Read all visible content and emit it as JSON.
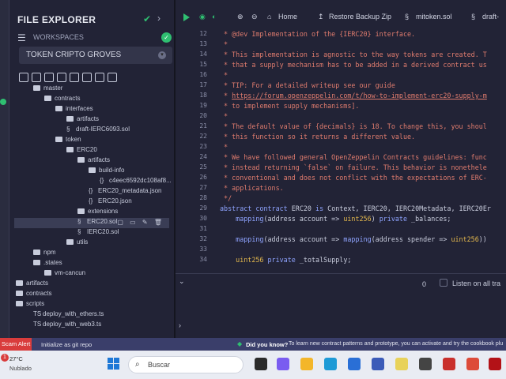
{
  "explorer": {
    "title": "FILE EXPLORER",
    "workspaces_label": "WORKSPACES",
    "workspace_selected": "TOKEN CRIPTO GROVES",
    "tree": [
      {
        "label": "master",
        "kind": "folder",
        "depth": 0
      },
      {
        "label": "contracts",
        "kind": "folder",
        "depth": 1
      },
      {
        "label": "interfaces",
        "kind": "folder",
        "depth": 2
      },
      {
        "label": "artifacts",
        "kind": "folder",
        "depth": 3
      },
      {
        "label": "draft-IERC6093.sol",
        "kind": "sol",
        "depth": 3
      },
      {
        "label": "token",
        "kind": "folder",
        "depth": 2
      },
      {
        "label": "ERC20",
        "kind": "folder",
        "depth": 3
      },
      {
        "label": "artifacts",
        "kind": "folder",
        "depth": 4
      },
      {
        "label": "build-info",
        "kind": "folder",
        "depth": 5
      },
      {
        "label": "c4eec6592dc108af8...",
        "kind": "json",
        "depth": 6
      },
      {
        "label": "ERC20_metadata.json",
        "kind": "json",
        "depth": 5
      },
      {
        "label": "ERC20.json",
        "kind": "json",
        "depth": 5
      },
      {
        "label": "extensions",
        "kind": "folder",
        "depth": 4
      },
      {
        "label": "ERC20.sol",
        "kind": "sol",
        "depth": 4,
        "selected": true
      },
      {
        "label": "IERC20.sol",
        "kind": "sol",
        "depth": 4
      },
      {
        "label": "utils",
        "kind": "folder",
        "depth": 3
      },
      {
        "label": "npm",
        "kind": "folder",
        "depth": 0
      },
      {
        "label": ".states",
        "kind": "folder",
        "depth": 0
      },
      {
        "label": "vm-cancun",
        "kind": "folder",
        "depth": 1
      },
      {
        "label": "artifacts",
        "kind": "folder",
        "depth": -1
      },
      {
        "label": "contracts",
        "kind": "folder",
        "depth": -1
      },
      {
        "label": "scripts",
        "kind": "folder",
        "depth": -1
      },
      {
        "label": "deploy_with_ethers.ts",
        "kind": "ts",
        "depth": 0
      },
      {
        "label": "deploy_with_web3.ts",
        "kind": "ts",
        "depth": 0
      }
    ]
  },
  "editor": {
    "tabs": [
      "Home",
      "Restore Backup Zip",
      "mitoken.sol",
      "draft-"
    ],
    "lines": [
      {
        "n": "12",
        "segs": [
          {
            "t": " * @dev Implementation of the {IERC20} interface.",
            "c": "cm"
          }
        ]
      },
      {
        "n": "13",
        "segs": [
          {
            "t": " *",
            "c": "cm"
          }
        ]
      },
      {
        "n": "14",
        "segs": [
          {
            "t": " * This implementation is agnostic to the way tokens are created. T",
            "c": "cm"
          }
        ]
      },
      {
        "n": "15",
        "segs": [
          {
            "t": " * that a supply mechanism has to be added in a derived contract us",
            "c": "cm"
          }
        ]
      },
      {
        "n": "16",
        "segs": [
          {
            "t": " *",
            "c": "cm"
          }
        ]
      },
      {
        "n": "17",
        "segs": [
          {
            "t": " * TIP: For a detailed writeup see our guide",
            "c": "cm"
          }
        ]
      },
      {
        "n": "18",
        "segs": [
          {
            "t": " * ",
            "c": "cm"
          },
          {
            "t": "https://forum.openzeppelin.com/t/how-to-implement-erc20-supply-m",
            "c": "cm-link"
          }
        ]
      },
      {
        "n": "19",
        "segs": [
          {
            "t": " * to implement supply mechanisms].",
            "c": "cm"
          }
        ]
      },
      {
        "n": "20",
        "segs": [
          {
            "t": " *",
            "c": "cm"
          }
        ]
      },
      {
        "n": "21",
        "segs": [
          {
            "t": " * The default value of {decimals} is 18. To change this, you shoul",
            "c": "cm"
          }
        ]
      },
      {
        "n": "22",
        "segs": [
          {
            "t": " * this function so it returns a different value.",
            "c": "cm"
          }
        ]
      },
      {
        "n": "23",
        "segs": [
          {
            "t": " *",
            "c": "cm"
          }
        ]
      },
      {
        "n": "24",
        "segs": [
          {
            "t": " * We have followed general OpenZeppelin Contracts guidelines: func",
            "c": "cm"
          }
        ]
      },
      {
        "n": "25",
        "segs": [
          {
            "t": " * instead returning `false` on failure. This behavior is nonethele",
            "c": "cm"
          }
        ]
      },
      {
        "n": "26",
        "segs": [
          {
            "t": " * conventional and does not conflict with the expectations of ERC-",
            "c": "cm"
          }
        ]
      },
      {
        "n": "27",
        "segs": [
          {
            "t": " * applications.",
            "c": "cm"
          }
        ]
      },
      {
        "n": "28",
        "segs": [
          {
            "t": " */",
            "c": "cm"
          }
        ]
      },
      {
        "n": "29",
        "segs": [
          {
            "t": "abstract contract ",
            "c": "kw"
          },
          {
            "t": "ERC20 ",
            "c": "pl"
          },
          {
            "t": "is ",
            "c": "kw"
          },
          {
            "t": "Context, IERC20, IERC20Metadata, IERC20Er",
            "c": "pl"
          }
        ]
      },
      {
        "n": "30",
        "segs": [
          {
            "t": "    mapping",
            "c": "kw"
          },
          {
            "t": "(address account => ",
            "c": "pl"
          },
          {
            "t": "uint256",
            "c": "ty"
          },
          {
            "t": ") ",
            "c": "pl"
          },
          {
            "t": "private ",
            "c": "kw"
          },
          {
            "t": "_balances;",
            "c": "pl"
          }
        ]
      },
      {
        "n": "31",
        "segs": [
          {
            "t": "",
            "c": "pl"
          }
        ]
      },
      {
        "n": "32",
        "segs": [
          {
            "t": "    mapping",
            "c": "kw"
          },
          {
            "t": "(address account => ",
            "c": "pl"
          },
          {
            "t": "mapping",
            "c": "kw"
          },
          {
            "t": "(address spender => ",
            "c": "pl"
          },
          {
            "t": "uint256",
            "c": "ty"
          },
          {
            "t": "))",
            "c": "pl"
          }
        ]
      },
      {
        "n": "33",
        "segs": [
          {
            "t": "",
            "c": "pl"
          }
        ]
      },
      {
        "n": "34",
        "segs": [
          {
            "t": "    uint256 ",
            "c": "ty"
          },
          {
            "t": "private ",
            "c": "kw"
          },
          {
            "t": "_totalSupply;",
            "c": "pl"
          }
        ]
      }
    ]
  },
  "terminal": {
    "count": "0",
    "listen_label": "Listen on all tra"
  },
  "statusbar": {
    "alert": "Scam Alert",
    "git": "Initialize as git repo",
    "tip_bold": "Did you know?",
    "tip": "To learn new contract patterns and prototype, you can activate and try the cookbook plu"
  },
  "taskbar": {
    "weather_badge": "1",
    "temperature": "27°C",
    "weather": "Nublado",
    "search_placeholder": "Buscar"
  },
  "colors": {
    "accent_green": "#2fbf71",
    "comment": "#e07c6e",
    "keyword": "#8fa4ff",
    "type": "#e3b84d",
    "statusbar": "#3a3e6a",
    "alert": "#d93c3c"
  }
}
